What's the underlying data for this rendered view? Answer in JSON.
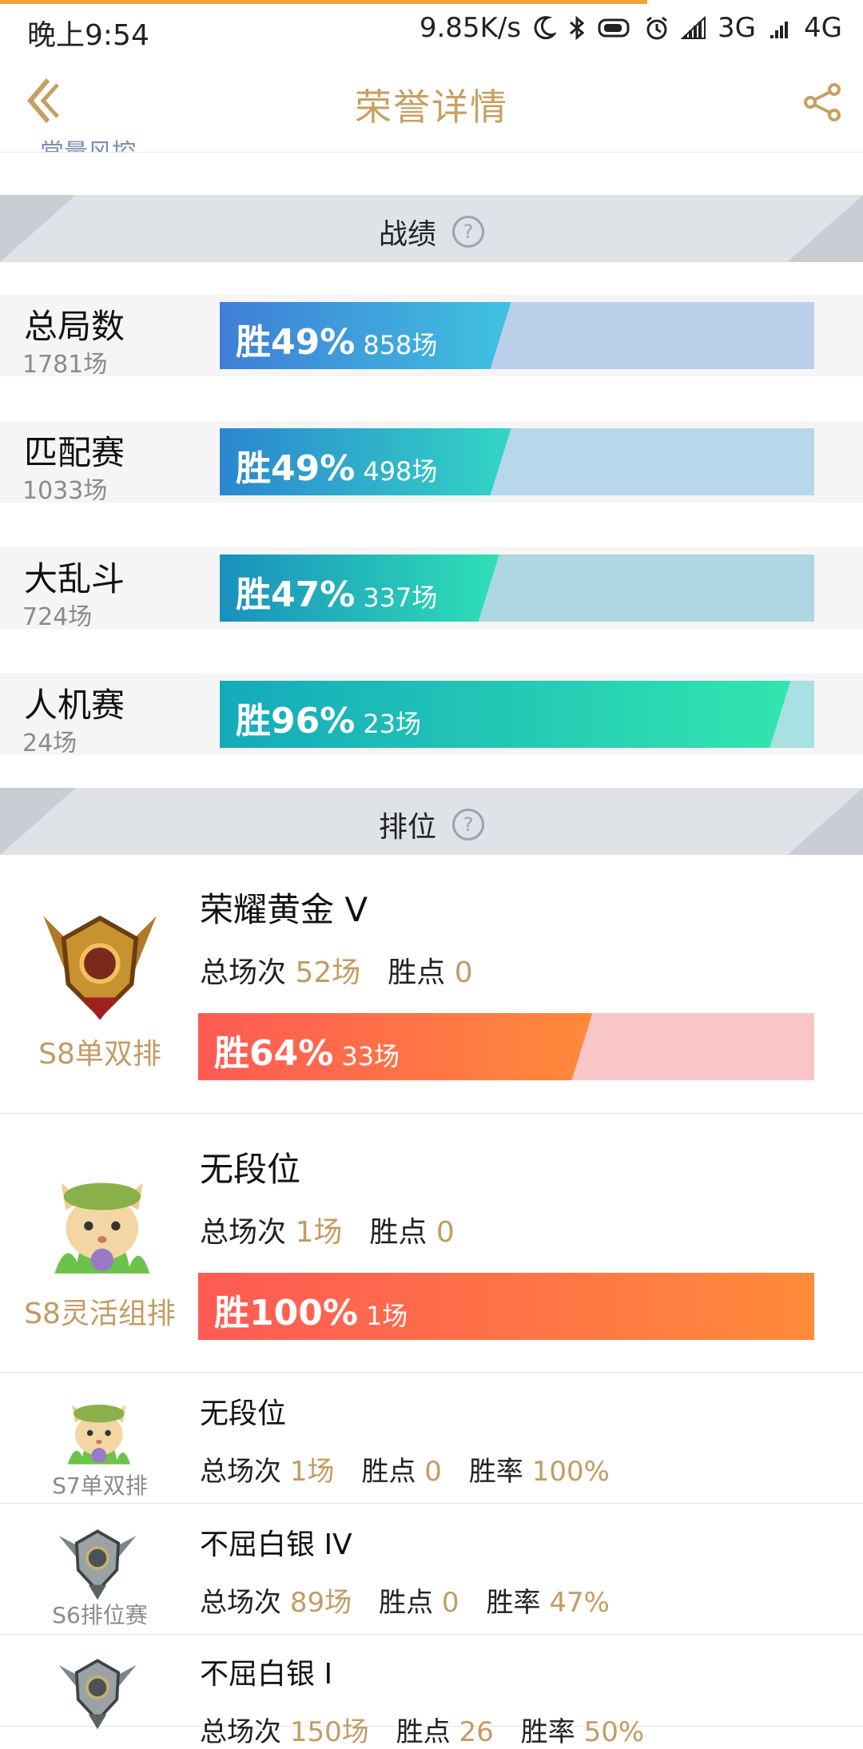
{
  "status_bar": {
    "time": "晚上9:54",
    "speed": "9.85K/s",
    "net1": "3G",
    "net2": "4G"
  },
  "nav": {
    "title": "荣誉详情",
    "back_icon": "back-arrow-icon",
    "share_icon": "share-icon"
  },
  "cutoff_text": "常量风控",
  "record": {
    "title": "战绩",
    "rows": [
      {
        "name": "总局数",
        "count": "1781场",
        "win_text": "胜49%",
        "games": "858场",
        "win_fraction": 0.49,
        "fill_color_a": "#3f7ed6",
        "fill_color_b": "#3fc2e0",
        "track_color": "#bcd0ec"
      },
      {
        "name": "匹配赛",
        "count": "1033场",
        "win_text": "胜49%",
        "games": "498场",
        "win_fraction": 0.49,
        "fill_color_a": "#2c86d0",
        "fill_color_b": "#32d6c4",
        "track_color": "#b7d7ea"
      },
      {
        "name": "大乱斗",
        "count": "724场",
        "win_text": "胜47%",
        "games": "337场",
        "win_fraction": 0.47,
        "fill_color_a": "#1a8fbe",
        "fill_color_b": "#2ee0b6",
        "track_color": "#acd7e2"
      },
      {
        "name": "人机赛",
        "count": "24场",
        "win_text": "胜96%",
        "games": "23场",
        "win_fraction": 0.96,
        "fill_color_a": "#14aabc",
        "fill_color_b": "#32e6ae",
        "track_color": "#a9e0e2"
      }
    ]
  },
  "ranked": {
    "title": "排位",
    "cards": [
      {
        "season": "S8单双排",
        "rank": "荣耀黄金 V",
        "total_label": "总场次",
        "total": "52场",
        "points_label": "胜点",
        "points": "0",
        "win_text": "胜64%",
        "games": "33场",
        "win_fraction": 0.64,
        "emblem": "gold-emblem-icon"
      },
      {
        "season": "S8灵活组排",
        "rank": "无段位",
        "total_label": "总场次",
        "total": "1场",
        "points_label": "胜点",
        "points": "0",
        "win_text": "胜100%",
        "games": "1场",
        "win_fraction": 1.0,
        "emblem": "teemo-avatar-icon"
      },
      {
        "season": "S7单双排",
        "rank": "无段位",
        "total_label": "总场次",
        "total": "1场",
        "points_label": "胜点",
        "points": "0",
        "rate_label": "胜率",
        "rate": "100%",
        "emblem": "teemo-avatar-icon"
      },
      {
        "season": "S6排位赛",
        "rank": "不屈白银 IV",
        "total_label": "总场次",
        "total": "89场",
        "points_label": "胜点",
        "points": "0",
        "rate_label": "胜率",
        "rate": "47%",
        "emblem": "silver-emblem-icon"
      },
      {
        "season": "",
        "rank": "不屈白银 I",
        "total_label": "总场次",
        "total": "150场",
        "points_label": "胜点",
        "points": "26",
        "rate_label": "胜率",
        "rate": "50%",
        "emblem": "silver-emblem-icon"
      }
    ],
    "bar_colors": {
      "fill_a": "#ff5a55",
      "fill_b": "#ff8a3a",
      "track": "#f9c6c7"
    }
  },
  "colors": {
    "accent": "#c79f62",
    "section_bg": "#dfe3e8"
  }
}
